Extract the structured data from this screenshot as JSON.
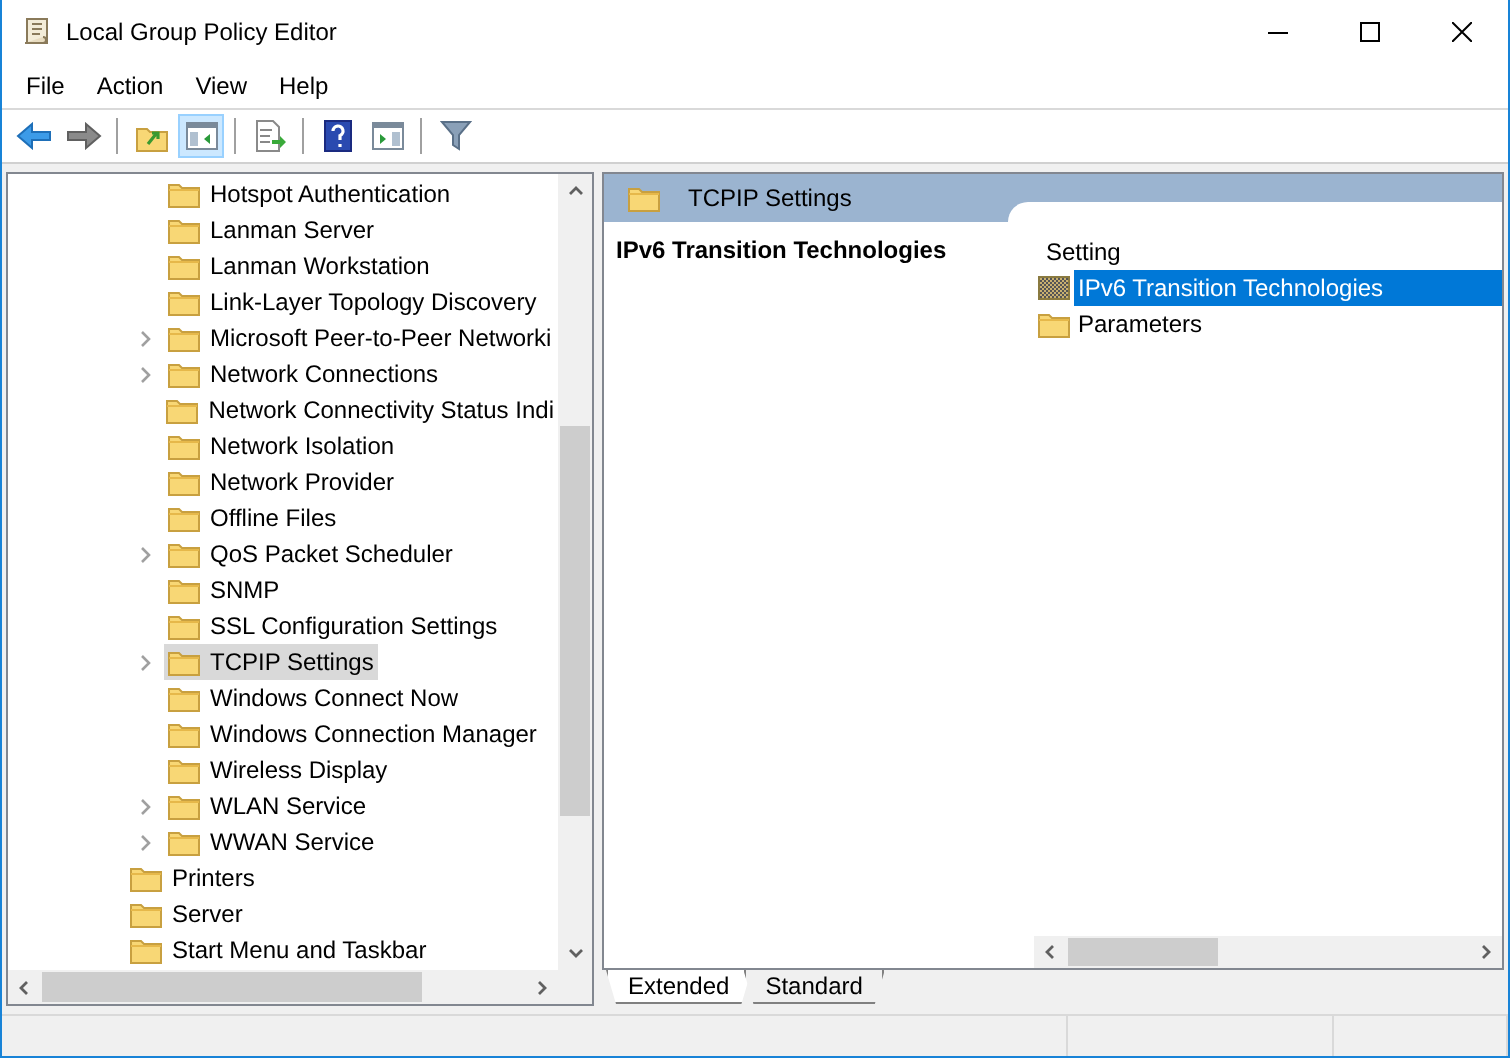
{
  "window": {
    "title": "Local Group Policy Editor"
  },
  "menu": [
    "File",
    "Action",
    "View",
    "Help"
  ],
  "toolbar": [
    {
      "kind": "back",
      "pressed": false
    },
    {
      "kind": "forward",
      "pressed": false
    },
    {
      "kind": "sep"
    },
    {
      "kind": "up",
      "pressed": false
    },
    {
      "kind": "tree",
      "pressed": true
    },
    {
      "kind": "sep"
    },
    {
      "kind": "export",
      "pressed": false
    },
    {
      "kind": "sep"
    },
    {
      "kind": "help",
      "pressed": false
    },
    {
      "kind": "pane",
      "pressed": false
    },
    {
      "kind": "sep"
    },
    {
      "kind": "filter",
      "pressed": false
    }
  ],
  "tree": {
    "children": [
      {
        "label": "Hotspot Authentication",
        "has_children": false,
        "selected": false
      },
      {
        "label": "Lanman Server",
        "has_children": false,
        "selected": false
      },
      {
        "label": "Lanman Workstation",
        "has_children": false,
        "selected": false
      },
      {
        "label": "Link-Layer Topology Discovery",
        "has_children": false,
        "selected": false
      },
      {
        "label": "Microsoft Peer-to-Peer Networki",
        "has_children": true,
        "selected": false
      },
      {
        "label": "Network Connections",
        "has_children": true,
        "selected": false
      },
      {
        "label": "Network Connectivity Status Indi",
        "has_children": false,
        "selected": false
      },
      {
        "label": "Network Isolation",
        "has_children": false,
        "selected": false
      },
      {
        "label": "Network Provider",
        "has_children": false,
        "selected": false
      },
      {
        "label": "Offline Files",
        "has_children": false,
        "selected": false
      },
      {
        "label": "QoS Packet Scheduler",
        "has_children": true,
        "selected": false
      },
      {
        "label": "SNMP",
        "has_children": false,
        "selected": false
      },
      {
        "label": "SSL Configuration Settings",
        "has_children": false,
        "selected": false
      },
      {
        "label": "TCPIP Settings",
        "has_children": true,
        "selected": true
      },
      {
        "label": "Windows Connect Now",
        "has_children": false,
        "selected": false
      },
      {
        "label": "Windows Connection Manager",
        "has_children": false,
        "selected": false
      },
      {
        "label": "Wireless Display",
        "has_children": false,
        "selected": false
      },
      {
        "label": "WLAN Service",
        "has_children": true,
        "selected": false
      },
      {
        "label": "WWAN Service",
        "has_children": true,
        "selected": false
      }
    ],
    "items": [
      {
        "label": "Printers",
        "has_children": false,
        "selected": false
      },
      {
        "label": "Server",
        "has_children": false,
        "selected": false
      },
      {
        "label": "Start Menu and Taskbar",
        "has_children": false,
        "selected": false
      }
    ]
  },
  "detail": {
    "header": "TCPIP Settings",
    "description_title": "IPv6 Transition Technologies",
    "column": "Setting",
    "rows": [
      {
        "label": "IPv6 Transition Technologies",
        "kind": "policy",
        "selected": true
      },
      {
        "label": "Parameters",
        "kind": "folder",
        "selected": false
      }
    ]
  },
  "view_tabs": [
    {
      "label": "Extended",
      "selected": true
    },
    {
      "label": "Standard",
      "selected": false
    }
  ]
}
